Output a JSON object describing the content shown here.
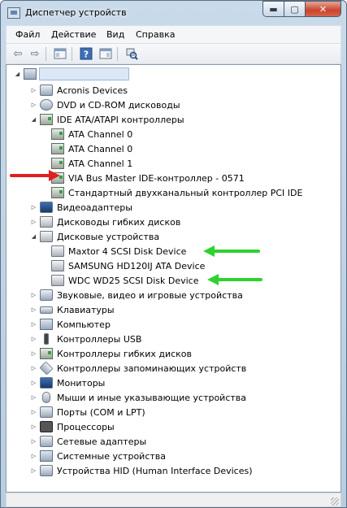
{
  "window": {
    "title": "Диспетчер устройств"
  },
  "titlebar_buttons": {
    "minimize": "▬",
    "maximize": "▢",
    "close": "✕"
  },
  "menu": [
    "Файл",
    "Действие",
    "Вид",
    "Справка"
  ],
  "toolbar_icons": [
    "back-arrow-icon",
    "forward-arrow-icon",
    "properties-icon",
    "help-icon",
    "console-tree-icon",
    "scan-hardware-icon"
  ],
  "tree": {
    "root_label": "",
    "nodes": [
      {
        "label": "Acronis Devices",
        "state": "collapsed"
      },
      {
        "label": "DVD и CD-ROM дисководы",
        "state": "collapsed"
      },
      {
        "label": "IDE ATA/ATAPI контроллеры",
        "state": "expanded"
      },
      {
        "label": "ATA Channel 0",
        "state": "leaf"
      },
      {
        "label": "ATA Channel 0",
        "state": "leaf"
      },
      {
        "label": "ATA Channel 1",
        "state": "leaf"
      },
      {
        "label": "VIA Bus Master IDE-контроллер - 0571",
        "state": "leaf"
      },
      {
        "label": "Стандартный двухканальный контроллер PCI IDE",
        "state": "leaf"
      },
      {
        "label": "Видеоадаптеры",
        "state": "collapsed"
      },
      {
        "label": "Дисководы гибких дисков",
        "state": "collapsed"
      },
      {
        "label": "Дисковые устройства",
        "state": "expanded"
      },
      {
        "label": "Maxtor 4  SCSI Disk Device",
        "state": "leaf"
      },
      {
        "label": "SAMSUNG HD120IJ ATA Device",
        "state": "leaf"
      },
      {
        "label": "WDC WD25  SCSI Disk Device",
        "state": "leaf"
      },
      {
        "label": "Звуковые, видео и игровые устройства",
        "state": "collapsed"
      },
      {
        "label": "Клавиатуры",
        "state": "collapsed"
      },
      {
        "label": "Компьютер",
        "state": "collapsed"
      },
      {
        "label": "Контроллеры USB",
        "state": "collapsed"
      },
      {
        "label": "Контроллеры гибких дисков",
        "state": "collapsed"
      },
      {
        "label": "Контроллеры запоминающих устройств",
        "state": "collapsed"
      },
      {
        "label": "Мониторы",
        "state": "collapsed"
      },
      {
        "label": "Мыши и иные указывающие устройства",
        "state": "collapsed"
      },
      {
        "label": "Порты (COM и LPT)",
        "state": "collapsed"
      },
      {
        "label": "Процессоры",
        "state": "collapsed"
      },
      {
        "label": "Сетевые адаптеры",
        "state": "collapsed"
      },
      {
        "label": "Системные устройства",
        "state": "collapsed"
      },
      {
        "label": "Устройства HID (Human Interface Devices)",
        "state": "collapsed"
      }
    ]
  },
  "annotations": {
    "red_arrow_color": "#e02020",
    "green_arrow_color": "#2fd12f"
  }
}
